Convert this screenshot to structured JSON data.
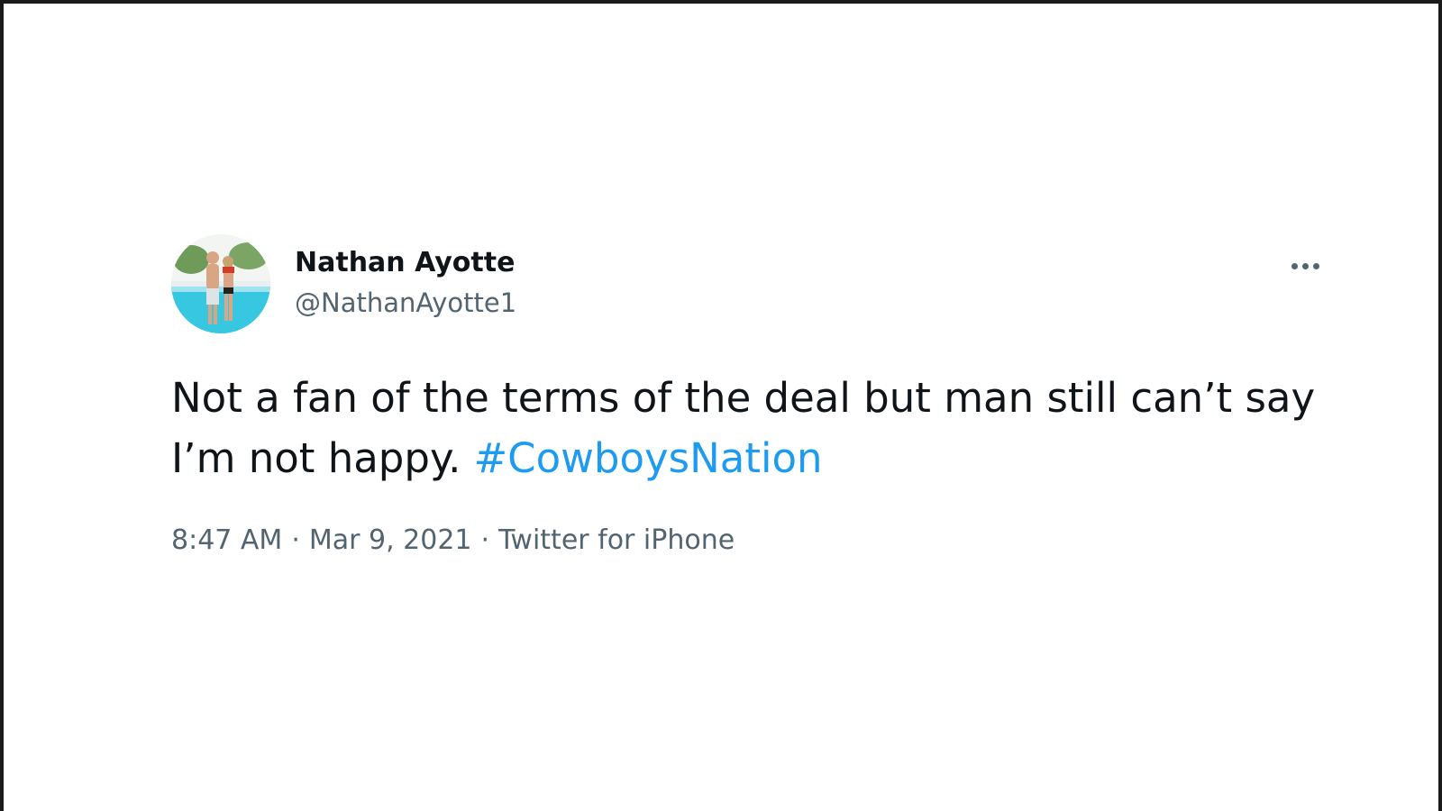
{
  "tweet": {
    "author": {
      "display_name": "Nathan Ayotte",
      "handle": "@NathanAyotte1"
    },
    "more_icon": "more-horizontal-icon",
    "text": "Not a fan of the terms of the deal but man still can’t say I’m not happy.",
    "hashtag": "#CowboysNation",
    "meta": {
      "time": "8:47 AM",
      "separator": "·",
      "date": "Mar 9, 2021",
      "source": "Twitter for iPhone"
    }
  },
  "colors": {
    "text_primary": "#0f1419",
    "text_secondary": "#536471",
    "link": "#1d9bf0",
    "frame_border": "#1a1a1a"
  }
}
